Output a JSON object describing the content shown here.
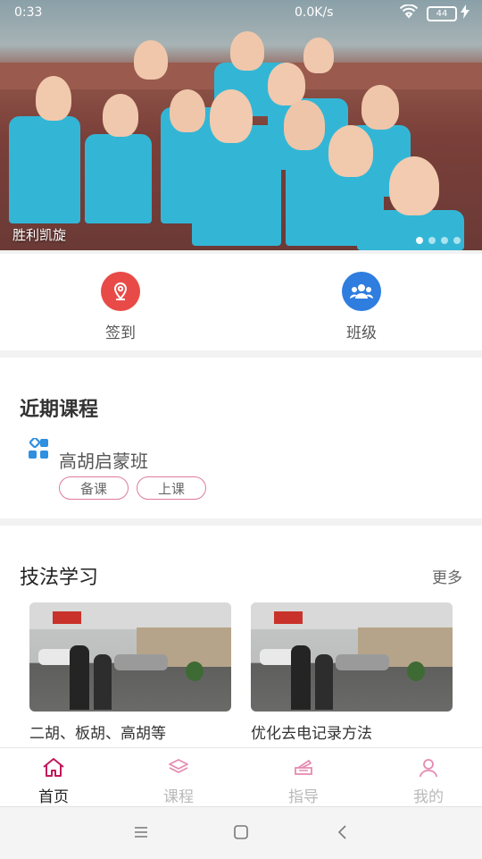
{
  "status_bar": {
    "time": "0:33",
    "network": "0.0K/s",
    "battery": "44"
  },
  "banner": {
    "caption": "胜利凯旋",
    "page_count": 4,
    "active_index": 0
  },
  "quick_actions": [
    {
      "label": "签到",
      "icon": "location-pin-icon",
      "color": "#e84b47"
    },
    {
      "label": "班级",
      "icon": "group-icon",
      "color": "#2f7ddf"
    }
  ],
  "recent_courses": {
    "title": "近期课程",
    "course": {
      "name": "高胡启蒙班",
      "buttons": [
        "备课",
        "上课"
      ]
    }
  },
  "technique": {
    "title": "技法学习",
    "more": "更多",
    "cards": [
      {
        "title": "二胡、板胡、高胡等"
      },
      {
        "title": "优化去电记录方法"
      }
    ]
  },
  "tabs": [
    {
      "label": "首页",
      "icon": "home-icon",
      "active": true
    },
    {
      "label": "课程",
      "icon": "layers-icon",
      "active": false
    },
    {
      "label": "指导",
      "icon": "piano-icon",
      "active": false
    },
    {
      "label": "我的",
      "icon": "person-icon",
      "active": false
    }
  ],
  "colors": {
    "accent": "#c2185b",
    "inactive": "#b9b9b9",
    "pill_border": "#e07aa0"
  }
}
